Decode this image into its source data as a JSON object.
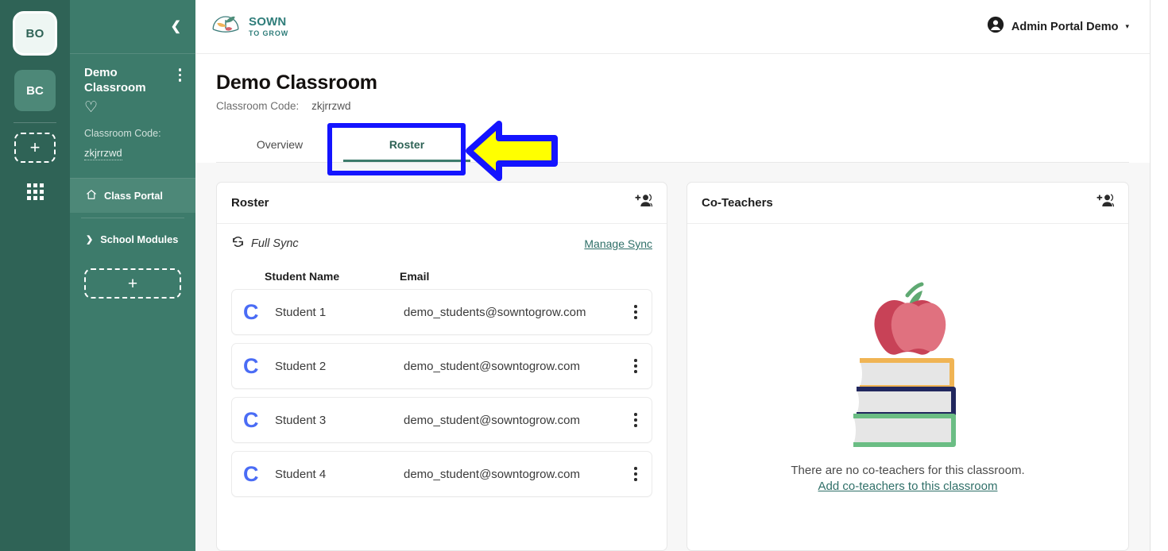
{
  "rail": {
    "org_initials": "BO",
    "class_initials": "BC",
    "add_label": "+",
    "apps_icon": "grid-icon"
  },
  "sidebar": {
    "collapse_icon": "chevron-left-icon",
    "classroom_name": "Demo Classroom",
    "favorite_icon": "heart-icon",
    "kebab_icon": "more-vertical-icon",
    "code_label": "Classroom Code:",
    "code_value": "zkjrrzwd",
    "nav": [
      {
        "label": "Class Portal",
        "icon": "home-icon",
        "active": true,
        "expandable": false
      },
      {
        "label": "School Modules",
        "icon": "chevron-right-icon",
        "active": false,
        "expandable": true
      }
    ],
    "add_label": "+"
  },
  "topbar": {
    "logo_line1": "SOWN",
    "logo_line2": "TO GROW",
    "logo_icon": "sown-to-grow-plant-logo",
    "user_icon": "account-circle-icon",
    "user_name": "Admin Portal Demo",
    "user_caret": "▾"
  },
  "page": {
    "title": "Demo Classroom",
    "code_label": "Classroom Code:",
    "code_value": "zkjrrzwd",
    "tabs": [
      {
        "label": "Overview",
        "active": false
      },
      {
        "label": "Roster",
        "active": true
      }
    ]
  },
  "roster": {
    "title": "Roster",
    "add_icon": "person-add-icon",
    "sync_icon": "sync-icon",
    "sync_label": "Full Sync",
    "manage_sync_link": "Manage Sync",
    "columns": {
      "name": "Student Name",
      "email": "Email"
    },
    "avatar_icon": "clever-c-icon",
    "row_menu_icon": "more-vertical-icon",
    "students": [
      {
        "avatar": "C",
        "name": "Student 1",
        "email": "demo_students@sowntogrow.com"
      },
      {
        "avatar": "C",
        "name": "Student 2",
        "email": "demo_student@sowntogrow.com"
      },
      {
        "avatar": "C",
        "name": "Student 3",
        "email": "demo_student@sowntogrow.com"
      },
      {
        "avatar": "C",
        "name": "Student 4",
        "email": "demo_student@sowntogrow.com"
      }
    ]
  },
  "coteachers": {
    "title": "Co-Teachers",
    "add_icon": "person-add-icon",
    "illustration": "apple-on-books-illustration",
    "empty_text": "There are no co-teachers for this classroom.",
    "empty_link": "Add co-teachers to this classroom"
  },
  "annotations": {
    "highlight_box": "roster-tab-highlight",
    "arrow": "pointer-arrow-left",
    "box_color": "#1414ff",
    "arrow_fill": "#ffff00",
    "arrow_stroke": "#1414ff"
  },
  "colors": {
    "rail_bg": "#2f6356",
    "sidebar_bg": "#3d7b6b",
    "sidebar_active": "#4d8878",
    "brand_teal": "#2f7d7a",
    "tab_active": "#2f6356",
    "link_teal": "#2f6f68",
    "clever_blue": "#4a6cf5",
    "apple_red": "#c84257",
    "apple_red_light": "#e0717f",
    "book_orange": "#f0b454",
    "book_navy": "#21275e",
    "book_green": "#6bbd84",
    "book_page": "#e3e3e3"
  }
}
